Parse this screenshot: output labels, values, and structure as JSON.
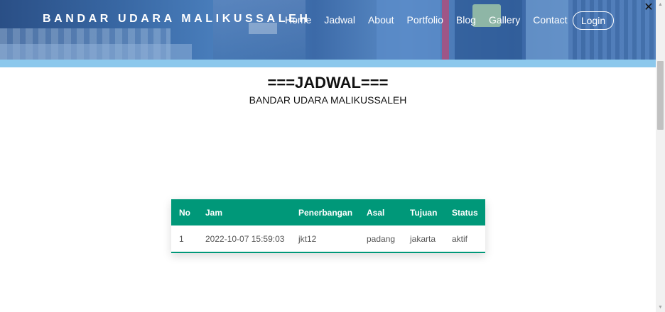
{
  "header": {
    "brand": "BANDAR UDARA MALIKUSSALEH",
    "nav": [
      "Home",
      "Jadwal",
      "About",
      "Portfolio",
      "Blog",
      "Gallery",
      "Contact"
    ],
    "login_label": "Login"
  },
  "main": {
    "title": "===JADWAL===",
    "subtitle": "BANDAR UDARA MALIKUSSALEH"
  },
  "table": {
    "headers": [
      "No",
      "Jam",
      "Penerbangan",
      "Asal",
      "Tujuan",
      "Status"
    ],
    "rows": [
      [
        "1",
        "2022-10-07 15:59:03",
        "jkt12",
        "padang",
        "jakarta",
        "aktif"
      ]
    ]
  },
  "colors": {
    "table_header": "#009879",
    "header_bar": "#8cc8ec"
  }
}
